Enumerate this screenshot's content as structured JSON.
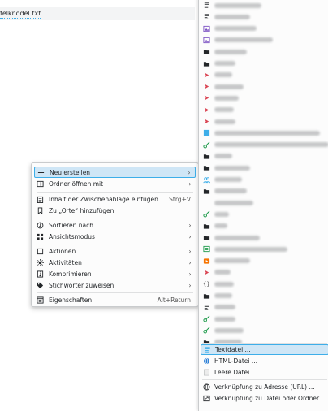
{
  "file": {
    "name": "felknödel.txt"
  },
  "context_menu": {
    "items": [
      {
        "label": "Neu erstellen",
        "shortcut": "",
        "icon": "plus-icon",
        "submenu": true
      },
      {
        "label": "Ordner öffnen mit",
        "shortcut": "",
        "icon": "open-folder-icon",
        "submenu": true
      },
      {
        "label": "Inhalt der Zwischenablage einfügen ...",
        "shortcut": "Strg+V",
        "icon": "paste-icon",
        "submenu": false
      },
      {
        "label": "Zu „Orte“ hinzufügen",
        "shortcut": "",
        "icon": "bookmark-icon",
        "submenu": false
      },
      {
        "label": "Sortieren nach",
        "shortcut": "",
        "icon": "sort-icon",
        "submenu": true
      },
      {
        "label": "Ansichtsmodus",
        "shortcut": "",
        "icon": "view-mode-icon",
        "submenu": true
      },
      {
        "label": "Aktionen",
        "shortcut": "",
        "icon": "actions-icon",
        "submenu": true
      },
      {
        "label": "Aktivitäten",
        "shortcut": "",
        "icon": "activities-icon",
        "submenu": true
      },
      {
        "label": "Komprimieren",
        "shortcut": "",
        "icon": "archive-icon",
        "submenu": true
      },
      {
        "label": "Stichwörter zuweisen",
        "shortcut": "",
        "icon": "tag-icon",
        "submenu": true
      },
      {
        "label": "Eigenschaften",
        "shortcut": "Alt+Return",
        "icon": "properties-icon",
        "submenu": false
      }
    ]
  },
  "submenu": {
    "bottom_items": [
      {
        "label": "Textdatei ...",
        "icon": "text-file-icon"
      },
      {
        "label": "HTML-Datei ...",
        "icon": "html-file-icon"
      },
      {
        "label": "Leere Datei ...",
        "icon": "empty-file-icon"
      },
      {
        "label": "Verknüpfung zu Adresse (URL) ...",
        "icon": "url-link-icon"
      },
      {
        "label": "Verknüpfung zu Datei oder Ordner ...",
        "icon": "file-link-icon"
      }
    ]
  },
  "colors": {
    "accent": "#3daee9",
    "highlight_bg": "#cfe6f6",
    "menu_bg": "#fcfcfc"
  }
}
